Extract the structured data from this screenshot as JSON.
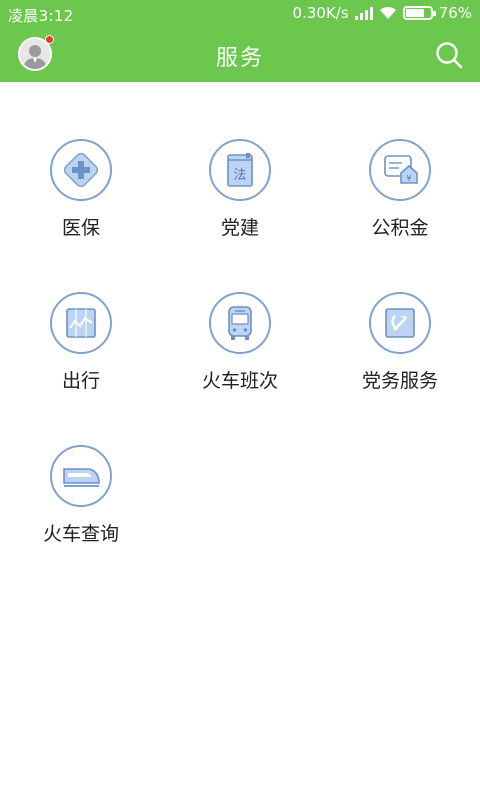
{
  "status_bar": {
    "time": "凌晨3:12",
    "speed": "0.30K/s",
    "battery": "76%",
    "battery_level": 0.76
  },
  "app_bar": {
    "title": "服务",
    "left_icon": "avatar",
    "right_icon": "search-icon"
  },
  "colors": {
    "header": "#6bc74e",
    "icon_border": "#7ea3cf",
    "icon_fill": "#bcd4f2"
  },
  "services": [
    {
      "label": "医保",
      "icon": "medical-cross-icon"
    },
    {
      "label": "党建",
      "icon": "law-book-icon"
    },
    {
      "label": "公积金",
      "icon": "housing-fund-icon"
    },
    {
      "label": "出行",
      "icon": "travel-chart-icon"
    },
    {
      "label": "火车班次",
      "icon": "bus-icon"
    },
    {
      "label": "党务服务",
      "icon": "party-emblem-icon"
    },
    {
      "label": "火车查询",
      "icon": "train-icon"
    }
  ]
}
